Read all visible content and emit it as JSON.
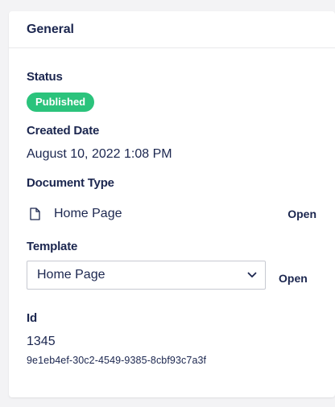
{
  "panel": {
    "title": "General"
  },
  "status": {
    "label": "Status",
    "badge": "Published",
    "badge_color": "#2bc37c"
  },
  "created": {
    "label": "Created Date",
    "value": "August 10, 2022 1:08 PM"
  },
  "document_type": {
    "label": "Document Type",
    "icon": "document-icon",
    "name": "Home Page",
    "open_label": "Open"
  },
  "template": {
    "label": "Template",
    "selected": "Home Page",
    "open_label": "Open"
  },
  "id": {
    "label": "Id",
    "value": "1345",
    "guid": "9e1eb4ef-30c2-4549-9385-8cbf93c7a3f"
  }
}
